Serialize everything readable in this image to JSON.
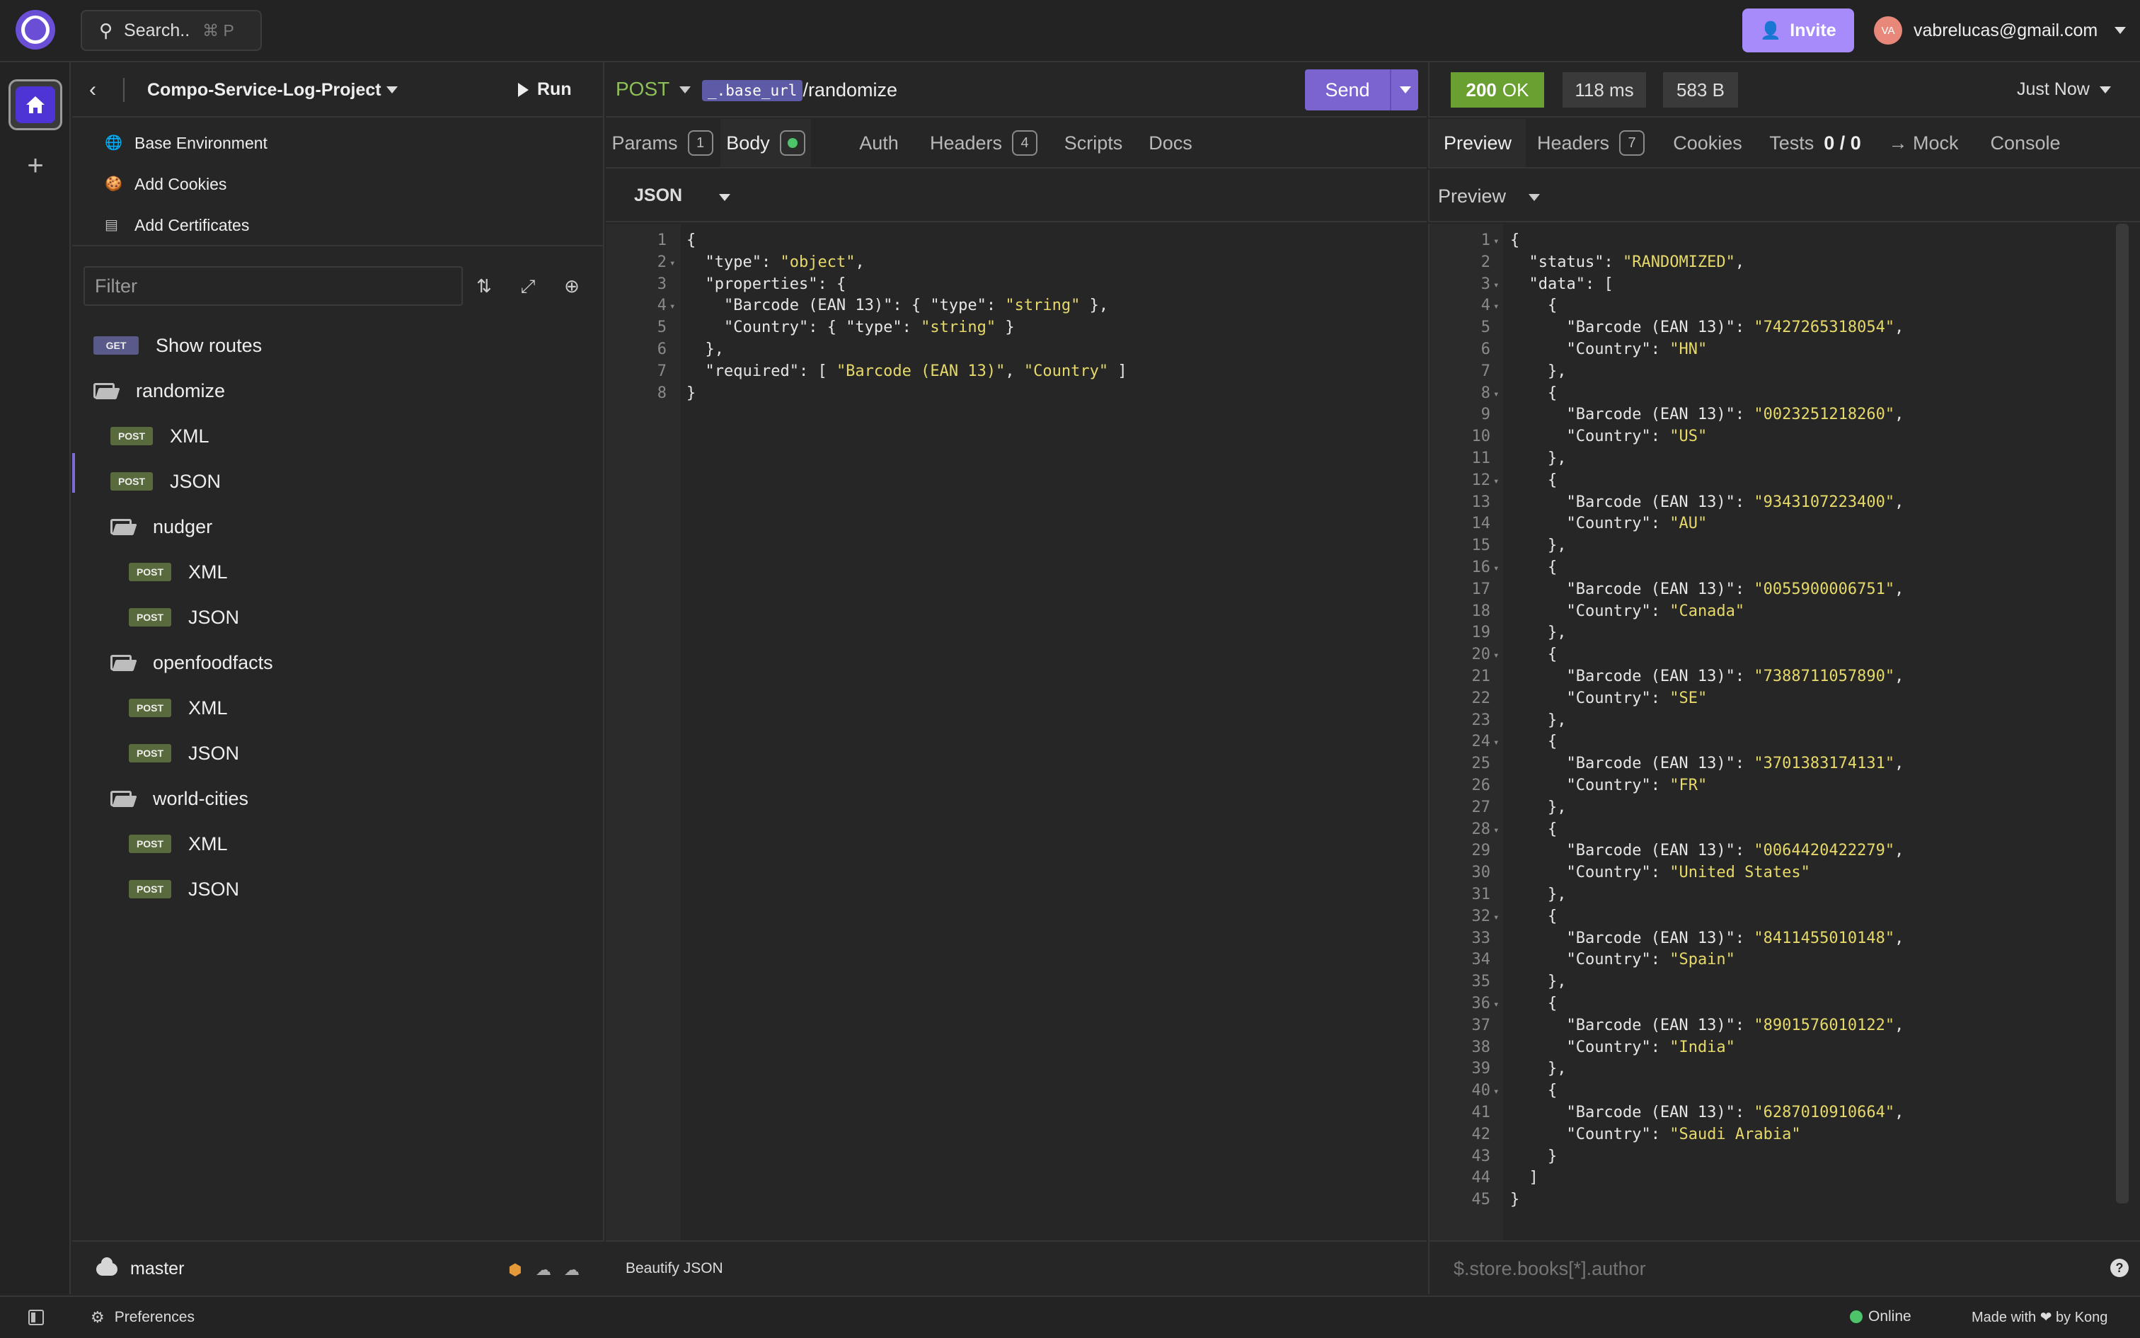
{
  "top": {
    "search_label": "Search..",
    "search_shortcut": "⌘ P",
    "invite_label": "Invite",
    "user_initials": "VA",
    "user_email": "vabrelucas@gmail.com"
  },
  "sidebar": {
    "project_name": "Compo-Service-Log-Project",
    "run_label": "Run",
    "env_items": [
      "Base Environment",
      "Add Cookies",
      "Add Certificates"
    ],
    "filter_placeholder": "Filter",
    "tree": [
      {
        "type": "request",
        "method": "GET",
        "label": "Show routes",
        "depth": 0
      },
      {
        "type": "folder",
        "label": "randomize",
        "depth": 0
      },
      {
        "type": "request",
        "method": "POST",
        "label": "XML",
        "depth": 1
      },
      {
        "type": "request",
        "method": "POST",
        "label": "JSON",
        "depth": 1,
        "active": true
      },
      {
        "type": "folder",
        "label": "nudger",
        "depth": 1
      },
      {
        "type": "request",
        "method": "POST",
        "label": "XML",
        "depth": 2
      },
      {
        "type": "request",
        "method": "POST",
        "label": "JSON",
        "depth": 2
      },
      {
        "type": "folder",
        "label": "openfoodfacts",
        "depth": 1
      },
      {
        "type": "request",
        "method": "POST",
        "label": "XML",
        "depth": 2
      },
      {
        "type": "request",
        "method": "POST",
        "label": "JSON",
        "depth": 2
      },
      {
        "type": "folder",
        "label": "world-cities",
        "depth": 1
      },
      {
        "type": "request",
        "method": "POST",
        "label": "XML",
        "depth": 2
      },
      {
        "type": "request",
        "method": "POST",
        "label": "JSON",
        "depth": 2
      }
    ],
    "branch": "master"
  },
  "request": {
    "method": "POST",
    "url_variable": "_.base_url",
    "url_path": "/randomize",
    "send_label": "Send",
    "tabs": [
      {
        "label": "Params",
        "count": "1"
      },
      {
        "label": "Body",
        "active": true
      },
      {
        "label": "Auth"
      },
      {
        "label": "Headers",
        "count": "4"
      },
      {
        "label": "Scripts"
      },
      {
        "label": "Docs"
      }
    ],
    "body_type": "JSON",
    "body_lines": [
      "{",
      "  \"type\": \"object\",",
      "  \"properties\": {",
      "    \"Barcode (EAN 13)\": { \"type\": \"string\" },",
      "    \"Country\": { \"type\": \"string\" }",
      "  },",
      "  \"required\": [ \"Barcode (EAN 13)\", \"Country\" ]",
      "}"
    ],
    "body_folds": [
      1,
      3
    ],
    "beautify_label": "Beautify JSON"
  },
  "response": {
    "status_code": "200",
    "status_text": "OK",
    "time": "118 ms",
    "size": "583 B",
    "timestamp": "Just Now",
    "tabs": [
      {
        "label": "Preview",
        "active": true
      },
      {
        "label": "Headers",
        "count": "7"
      },
      {
        "label": "Cookies"
      },
      {
        "label": "Tests",
        "count": "0 / 0"
      },
      {
        "label": "→ Mock"
      },
      {
        "label": "Console"
      }
    ],
    "preview_mode": "Preview",
    "status_value": "RANDOMIZED",
    "items": [
      {
        "barcode": "7427265318054",
        "country": "HN"
      },
      {
        "barcode": "0023251218260",
        "country": "US"
      },
      {
        "barcode": "9343107223400",
        "country": "AU"
      },
      {
        "barcode": "0055900006751",
        "country": "Canada"
      },
      {
        "barcode": "7388711057890",
        "country": "SE"
      },
      {
        "barcode": "3701383174131",
        "country": "FR"
      },
      {
        "barcode": "0064420422279",
        "country": "United States"
      },
      {
        "barcode": "8411455010148",
        "country": "Spain"
      },
      {
        "barcode": "8901576010122",
        "country": "India"
      },
      {
        "barcode": "6287010910664",
        "country": "Saudi Arabia"
      }
    ],
    "jsonpath_placeholder": "$.store.books[*].author"
  },
  "statusbar": {
    "preferences_label": "Preferences",
    "online_label": "Online",
    "made_with_label": "Made with ❤ by Kong"
  },
  "colors": {
    "accent": "#7b63d0",
    "invite": "#a78bfa",
    "post_badge": "#596b3d",
    "get_badge": "#5a5a8a",
    "status_ok": "#6aa032",
    "json_key": "#e6e6e6",
    "json_string": "#e6d96a"
  }
}
